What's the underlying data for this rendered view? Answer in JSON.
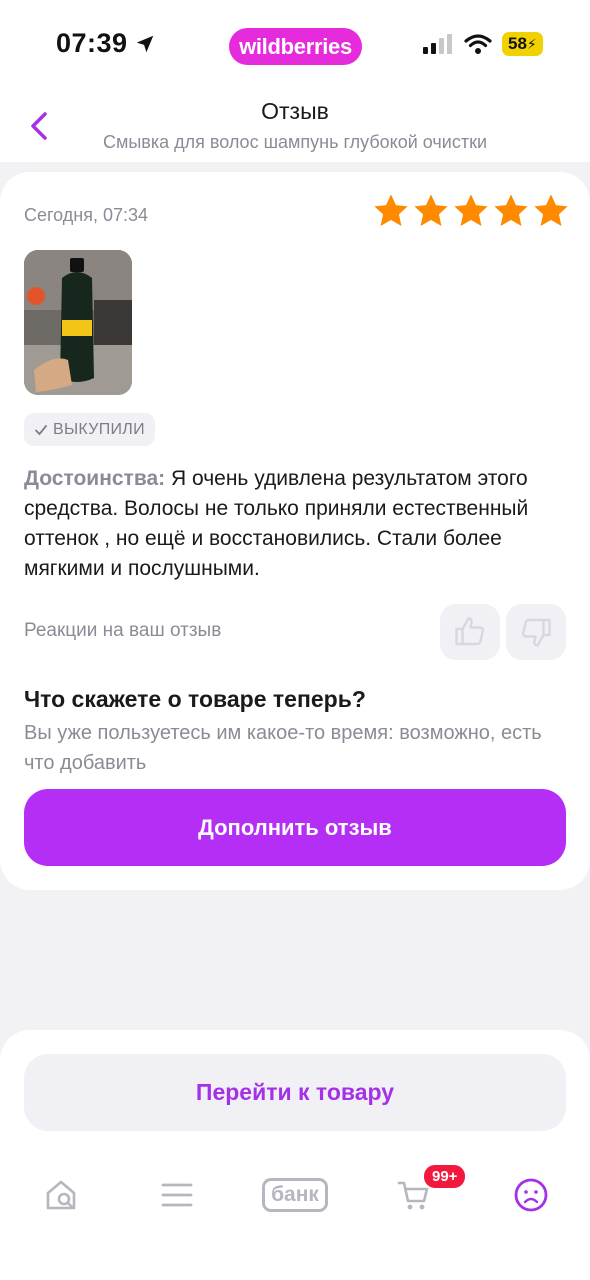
{
  "statusbar": {
    "time": "07:39",
    "brand": "wildberries",
    "battery": "58"
  },
  "header": {
    "title": "Отзыв",
    "subtitle": "Смывка для волос шампунь глубокой очистки"
  },
  "review": {
    "date": "Сегодня, 07:34",
    "rating": 5,
    "bought_label": "ВЫКУПИЛИ",
    "pros_label": "Достоинства:",
    "pros_text": " Я очень удивлена результатом этого средства. Волосы не только приняли естественный оттенок , но ещё и восстановились. Стали более мягкими и послушными.",
    "reactions_label": "Реакции на ваш отзыв"
  },
  "prompt": {
    "title": "Что скажете о товаре теперь?",
    "subtitle": "Вы уже пользуетесь им какое-то время: возможно, есть что добавить",
    "button": "Дополнить отзыв"
  },
  "bottom": {
    "goto_button": "Перейти к товару",
    "nav": {
      "bank": "банк",
      "cart_badge": "99+"
    }
  },
  "colors": {
    "accent": "#b42ef5",
    "star": "#ff8a00",
    "muted": "#8b8b97",
    "badge": "#f1193d"
  }
}
